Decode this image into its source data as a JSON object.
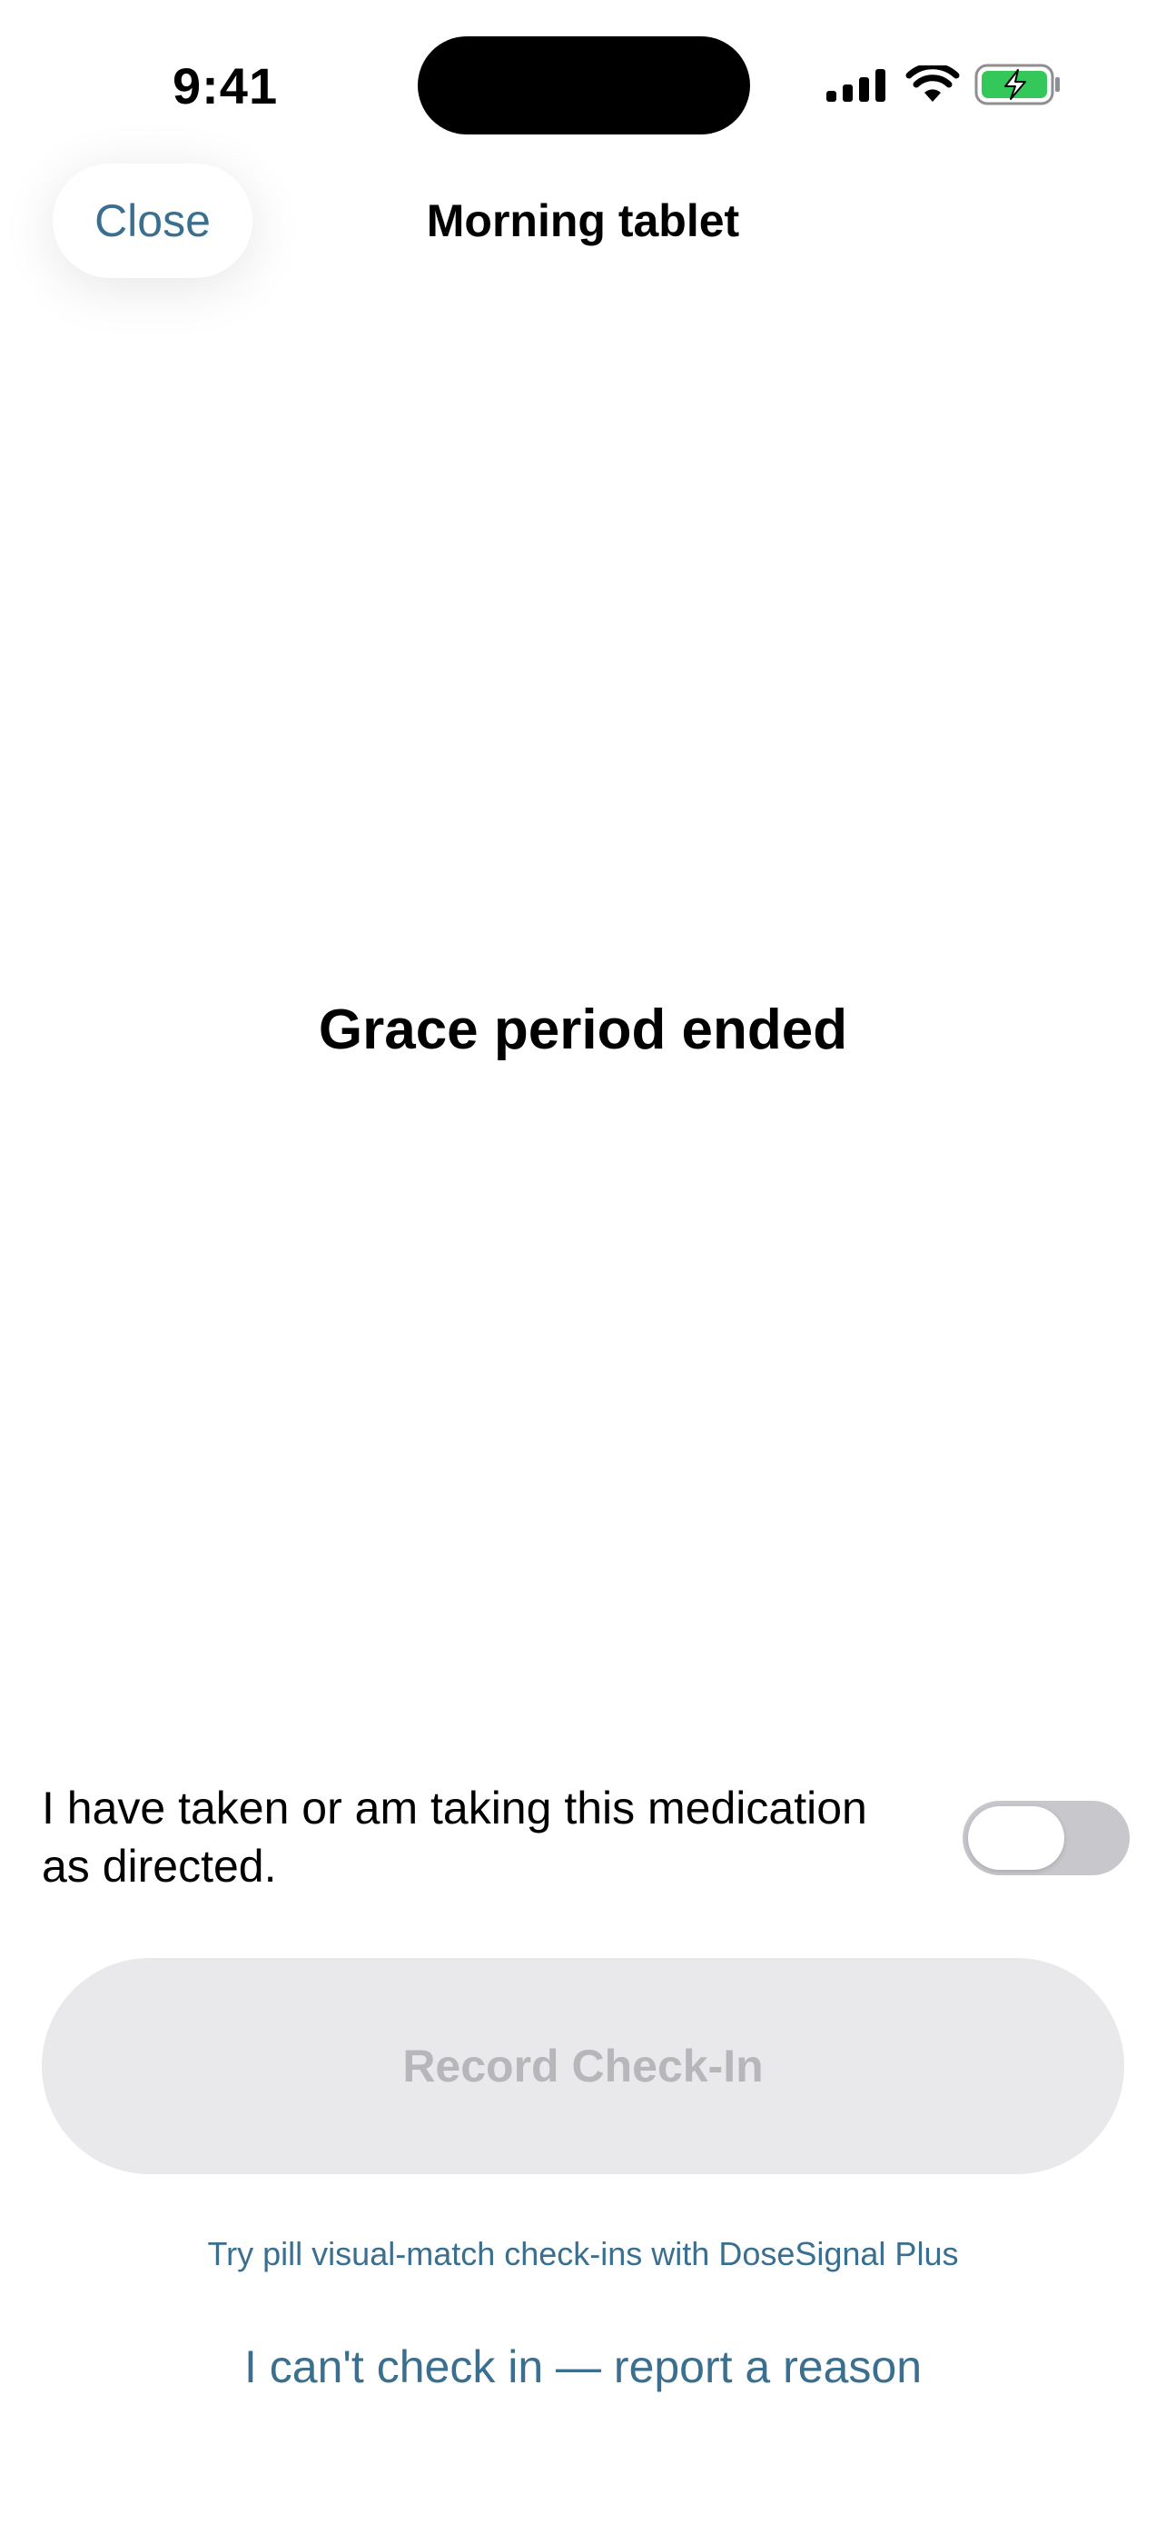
{
  "status_bar": {
    "time": "9:41",
    "signal_icon": "cellular-signal-icon",
    "wifi_icon": "wifi-icon",
    "battery_icon": "battery-charging-icon",
    "battery_color": "#34c759"
  },
  "header": {
    "close_label": "Close",
    "title": "Morning tablet"
  },
  "main": {
    "message": "Grace period ended"
  },
  "confirm": {
    "label": "I have taken or am taking this medication as directed.",
    "toggle_on": false
  },
  "actions": {
    "record_label": "Record Check-In",
    "record_enabled": false
  },
  "footer": {
    "promo_text": "Try pill visual-match check-ins with DoseSignal Plus",
    "report_text": "I can't check in — report a reason"
  },
  "colors": {
    "accent": "#3a6f8f",
    "disabled_bg": "#e9e9eb",
    "disabled_text": "#b7b7bb",
    "toggle_off": "#c7c7cc"
  }
}
